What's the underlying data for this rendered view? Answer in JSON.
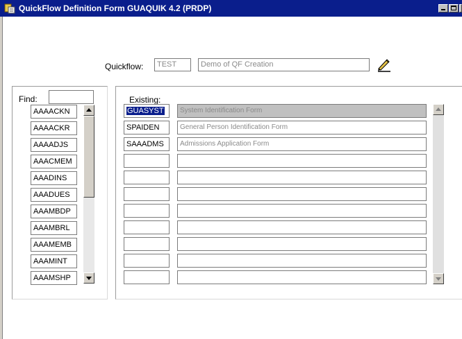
{
  "window": {
    "title": "QuickFlow Definition Form  GUAQUIK  4.2  (PRDP)",
    "title_bar_color": "#0a1e8c",
    "icon": "oracle-forms-app-icon",
    "controls": [
      "minimize-icon",
      "maximize-icon",
      "close-icon"
    ]
  },
  "header": {
    "quickflow_label": "Quickflow:",
    "quickflow_code": "TEST",
    "quickflow_description": "Demo of QF Creation",
    "search_icon": "pencil-search-icon"
  },
  "left_panel": {
    "find_label": "Find:",
    "find_value": "",
    "items": [
      "AAAACKN",
      "AAAACKR",
      "AAAADJS",
      "AAACMEM",
      "AAADINS",
      "AAADUES",
      "AAAMBDP",
      "AAAMBRL",
      "AAAMEMB",
      "AAAMINT",
      "AAAMSHP"
    ]
  },
  "right_panel": {
    "existing_label": "Existing:",
    "selected_color": "#0a1e8c",
    "rows": [
      {
        "code": "GUASYST",
        "description": "System Identification Form"
      },
      {
        "code": "SPAIDEN",
        "description": "General Person Identification Form"
      },
      {
        "code": "SAAADMS",
        "description": "Admissions Application Form"
      },
      {
        "code": "",
        "description": ""
      },
      {
        "code": "",
        "description": ""
      },
      {
        "code": "",
        "description": ""
      },
      {
        "code": "",
        "description": ""
      },
      {
        "code": "",
        "description": ""
      },
      {
        "code": "",
        "description": ""
      },
      {
        "code": "",
        "description": ""
      },
      {
        "code": "",
        "description": ""
      }
    ]
  }
}
